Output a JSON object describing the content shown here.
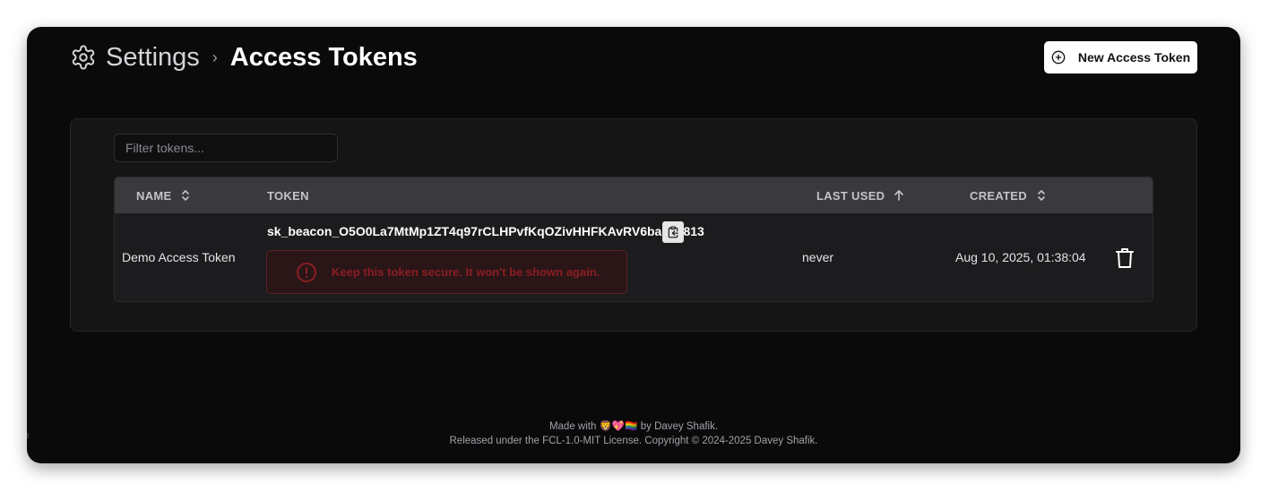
{
  "breadcrumb": {
    "settings": "Settings",
    "separator": "›",
    "current": "Access Tokens"
  },
  "header": {
    "new_token_button": "New Access Token",
    "new_token_icon": "plus-circle-icon"
  },
  "filter": {
    "placeholder": "Filter tokens..."
  },
  "table": {
    "columns": [
      {
        "label": "NAME",
        "sort": "unsorted"
      },
      {
        "label": "TOKEN",
        "sort": "none"
      },
      {
        "label": "LAST USED",
        "sort": "ascending"
      },
      {
        "label": "CREATED",
        "sort": "unsorted"
      }
    ],
    "rows": [
      {
        "name": "Demo Access Token",
        "token": "sk_beacon_O5O0La7MtMp1ZT4q97rCLHPvfKqOZivHHFKAvRV6bacba813",
        "warning": "Keep this token secure. It won't be shown again.",
        "last_used": "never",
        "created": "Aug 10, 2025, 01:38:04"
      }
    ]
  },
  "footer": {
    "line1_prefix": "Made with",
    "line1_emoji": "🦁💖🏳️‍🌈",
    "line1_suffix": "by Davey Shafik.",
    "line2": "Released under the FCL-1.0-MIT License. Copyright © 2024-2025 Davey Shafik."
  },
  "colors": {
    "background": "#0a0a0b",
    "card": "#151516",
    "table_header": "#3a3a3d",
    "warning_text": "#8b1e22",
    "warning_bg": "#2a1517"
  }
}
